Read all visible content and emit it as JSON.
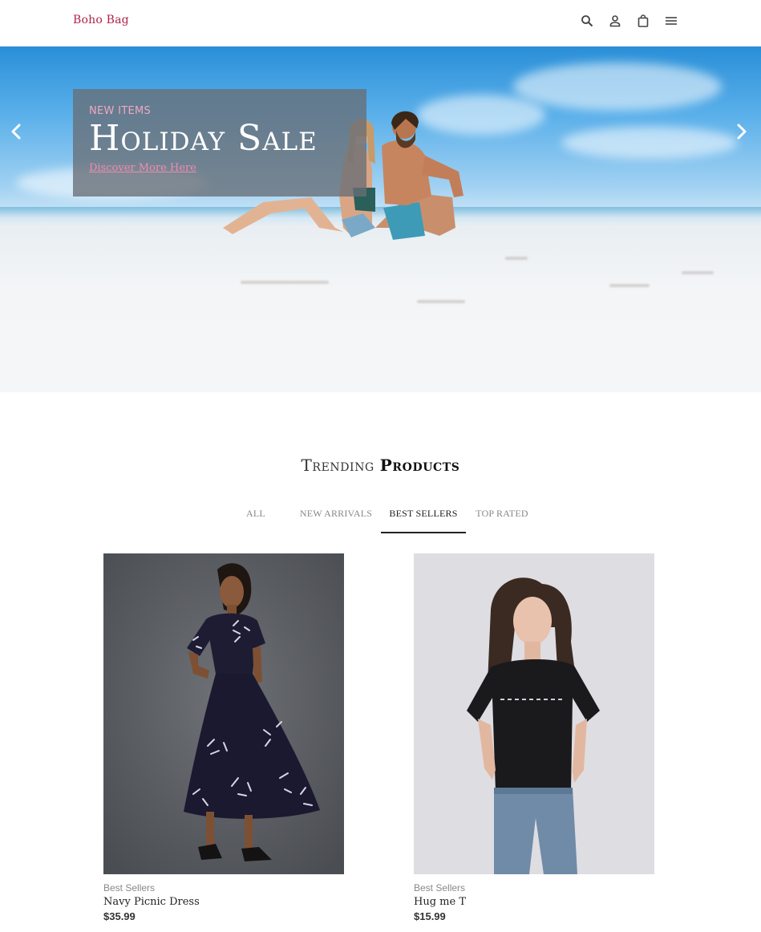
{
  "header": {
    "logo": "Boho Bag",
    "icons": [
      "search-icon",
      "user-icon",
      "shopping-bag-icon",
      "menu-icon"
    ]
  },
  "hero": {
    "eyebrow": "NEW ITEMS",
    "title": "Holiday Sale",
    "link_label": "Discover More Here",
    "icons": [
      "chevron-left-icon",
      "chevron-right-icon"
    ]
  },
  "trending": {
    "title_light": "Trending",
    "title_bold": "Products",
    "tabs": [
      {
        "label": "ALL"
      },
      {
        "label": "NEW ARRIVALS"
      },
      {
        "label": "BEST SELLERS"
      },
      {
        "label": "TOP RATED"
      }
    ],
    "active_tab": "BEST SELLERS"
  },
  "products": [
    {
      "category": "Best Sellers",
      "name": "Navy Picnic Dress",
      "price": "$35.99"
    },
    {
      "category": "Best Sellers",
      "name": "Hug me T",
      "price": "$15.99"
    }
  ],
  "colors": {
    "brand": "#b0224a",
    "eyebrow": "#f0a8c0",
    "link": "#f08bb0"
  }
}
